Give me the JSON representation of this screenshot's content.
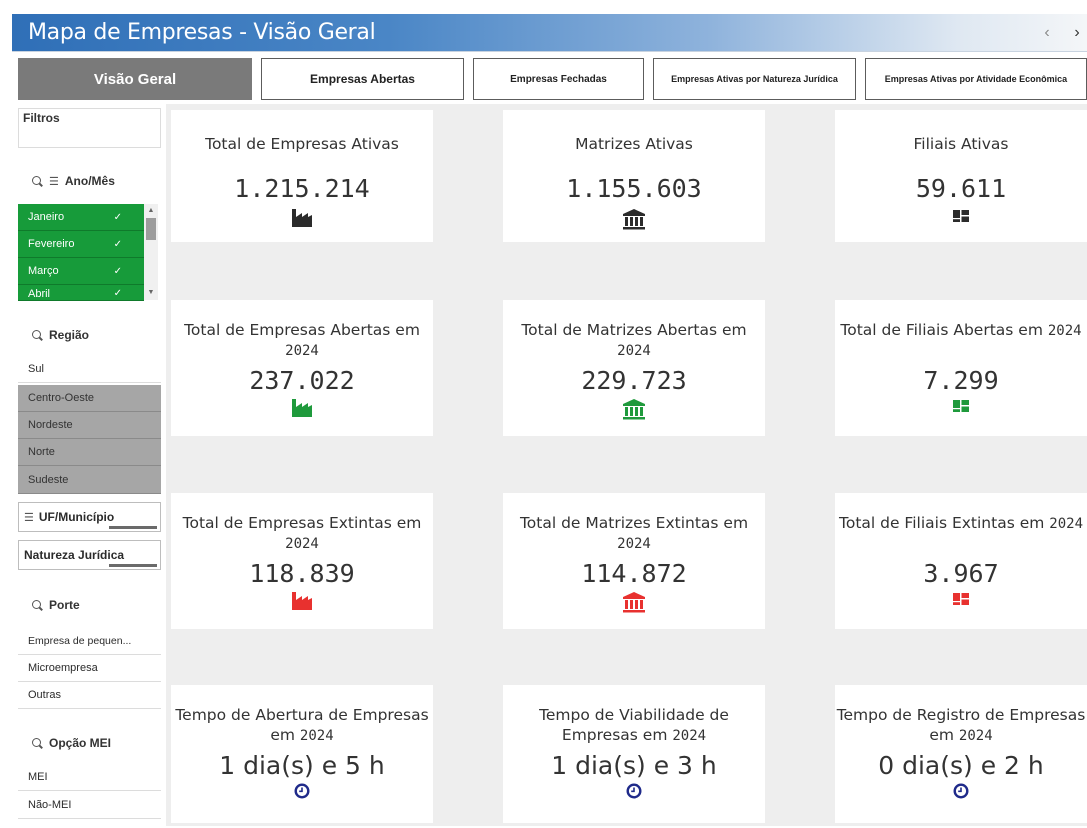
{
  "window": {
    "title": "Mapa de Empresas - Visão Geral",
    "nav_prev": "‹",
    "nav_next": "›"
  },
  "tabs": [
    {
      "label": "Visão Geral",
      "active": true
    },
    {
      "label": "Empresas Abertas",
      "active": false
    },
    {
      "label": "Empresas Fechadas",
      "active": false
    },
    {
      "label": "Empresas Ativas por Natureza Jurídica",
      "active": false
    },
    {
      "label": "Empresas Ativas por Atividade Econômica",
      "active": false
    }
  ],
  "sidebar": {
    "filters_title": "Filtros",
    "ano_mes": {
      "label": "Ano/Mês",
      "items": [
        {
          "label": "Janeiro",
          "selected": true
        },
        {
          "label": "Fevereiro",
          "selected": true
        },
        {
          "label": "Março",
          "selected": true
        },
        {
          "label": "Abril",
          "selected": true
        }
      ]
    },
    "regiao": {
      "label": "Região",
      "items": [
        {
          "label": "Sul",
          "state": "available"
        },
        {
          "label": "Centro-Oeste",
          "state": "excluded"
        },
        {
          "label": "Nordeste",
          "state": "excluded"
        },
        {
          "label": "Norte",
          "state": "excluded"
        },
        {
          "label": "Sudeste",
          "state": "excluded"
        }
      ]
    },
    "uf_municipio": {
      "label": "UF/Município"
    },
    "natureza_juridica": {
      "label": "Natureza Jurídica"
    },
    "porte": {
      "label": "Porte",
      "items": [
        {
          "label": "Empresa de pequen..."
        },
        {
          "label": "Microempresa"
        },
        {
          "label": "Outras"
        }
      ]
    },
    "opcao_mei": {
      "label": "Opção MEI",
      "items": [
        {
          "label": "MEI"
        },
        {
          "label": "Não-MEI"
        }
      ]
    }
  },
  "cards": {
    "row1": [
      {
        "title": "Total de Empresas Ativas",
        "value": "1.215.214",
        "icon": "factory-icon",
        "color": "#2b2b2b"
      },
      {
        "title": "Matrizes Ativas",
        "value": "1.155.603",
        "icon": "bank-icon",
        "color": "#2b2b2b"
      },
      {
        "title": "Filiais Ativas",
        "value": "59.611",
        "icon": "building-icon",
        "color": "#2b2b2b"
      }
    ],
    "row2": [
      {
        "title": "Total de Empresas Abertas em",
        "year": "2024",
        "value": "237.022",
        "icon": "factory-icon",
        "color": "#1f9a3c"
      },
      {
        "title": "Total de Matrizes Abertas em",
        "year": "2024",
        "value": "229.723",
        "icon": "bank-icon",
        "color": "#1f9a3c"
      },
      {
        "title": "Total de Filiais Abertas em",
        "year": "2024",
        "value": "7.299",
        "icon": "building-icon",
        "color": "#1f9a3c"
      }
    ],
    "row3": [
      {
        "title": "Total de Empresas Extintas em",
        "year": "2024",
        "value": "118.839",
        "icon": "factory-icon",
        "color": "#e8312f"
      },
      {
        "title": "Total de Matrizes Extintas em",
        "year": "2024",
        "value": "114.872",
        "icon": "bank-icon",
        "color": "#e8312f"
      },
      {
        "title": "Total de Filiais Extintas em",
        "year": "2024",
        "value": "3.967",
        "icon": "building-icon",
        "color": "#e8312f"
      }
    ],
    "row4": [
      {
        "title": "Tempo de Abertura de Empresas",
        "title2": "em",
        "year": "2024",
        "value": "1 dia(s) e 5 h",
        "icon": "clock-icon",
        "color": "#1f2a8a"
      },
      {
        "title": "Tempo de Viabilidade de",
        "title2": "Empresas em",
        "year": "2024",
        "value": "1 dia(s) e 3 h",
        "icon": "clock-icon",
        "color": "#1f2a8a"
      },
      {
        "title": "Tempo de Registro de Empresas",
        "title2": "em",
        "year": "2024",
        "value": "0 dia(s) e 2 h",
        "icon": "clock-icon",
        "color": "#1f2a8a"
      }
    ]
  }
}
